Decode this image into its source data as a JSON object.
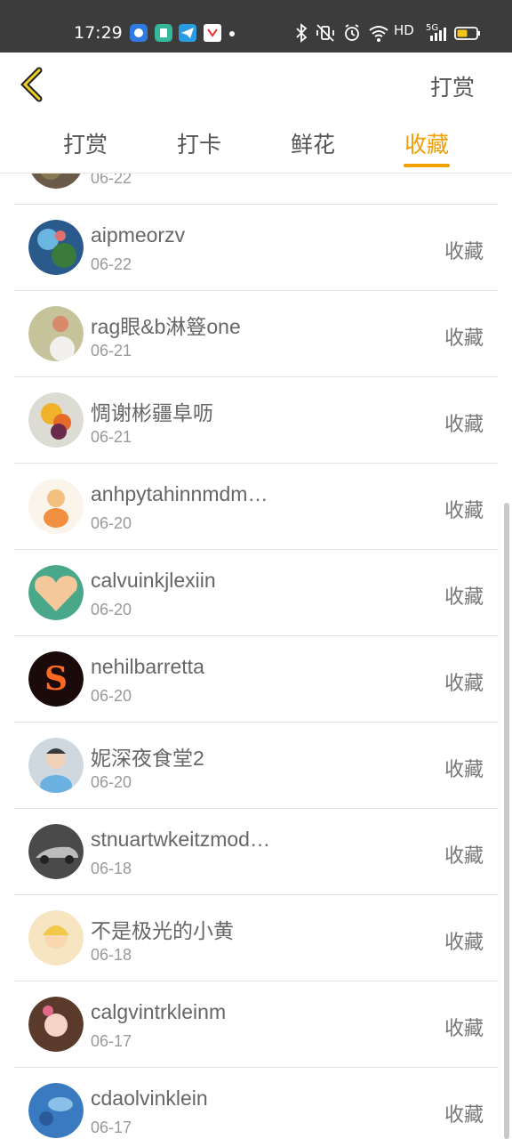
{
  "status": {
    "time": "17:29",
    "network": "HD",
    "cell": "5G"
  },
  "header": {
    "action_label": "打赏"
  },
  "tabs": [
    "打赏",
    "打卡",
    "鲜花",
    "收藏"
  ],
  "list": {
    "partial_date": "06-22",
    "items": [
      {
        "name": "aipmeorzv",
        "date": "06-22",
        "action": "收藏"
      },
      {
        "name": "rag眼&b淋簦one",
        "date": "06-21",
        "action": "收藏"
      },
      {
        "name": "惆谢彬疆阜呖",
        "date": "06-21",
        "action": "收藏"
      },
      {
        "name": "anhpytahinnmdm…",
        "date": "06-20",
        "action": "收藏"
      },
      {
        "name": "calvuinkjlexiin",
        "date": "06-20",
        "action": "收藏"
      },
      {
        "name": "nehilbarretta",
        "date": "06-20",
        "action": "收藏"
      },
      {
        "name": "妮深夜食堂2",
        "date": "06-20",
        "action": "收藏"
      },
      {
        "name": "stnuartwkeitzmod…",
        "date": "06-18",
        "action": "收藏"
      },
      {
        "name": "不是极光的小黄",
        "date": "06-18",
        "action": "收藏"
      },
      {
        "name": "calgvintrkleinm",
        "date": "06-17",
        "action": "收藏"
      },
      {
        "name": "cdaolvinklein",
        "date": "06-17",
        "action": "收藏"
      }
    ]
  }
}
